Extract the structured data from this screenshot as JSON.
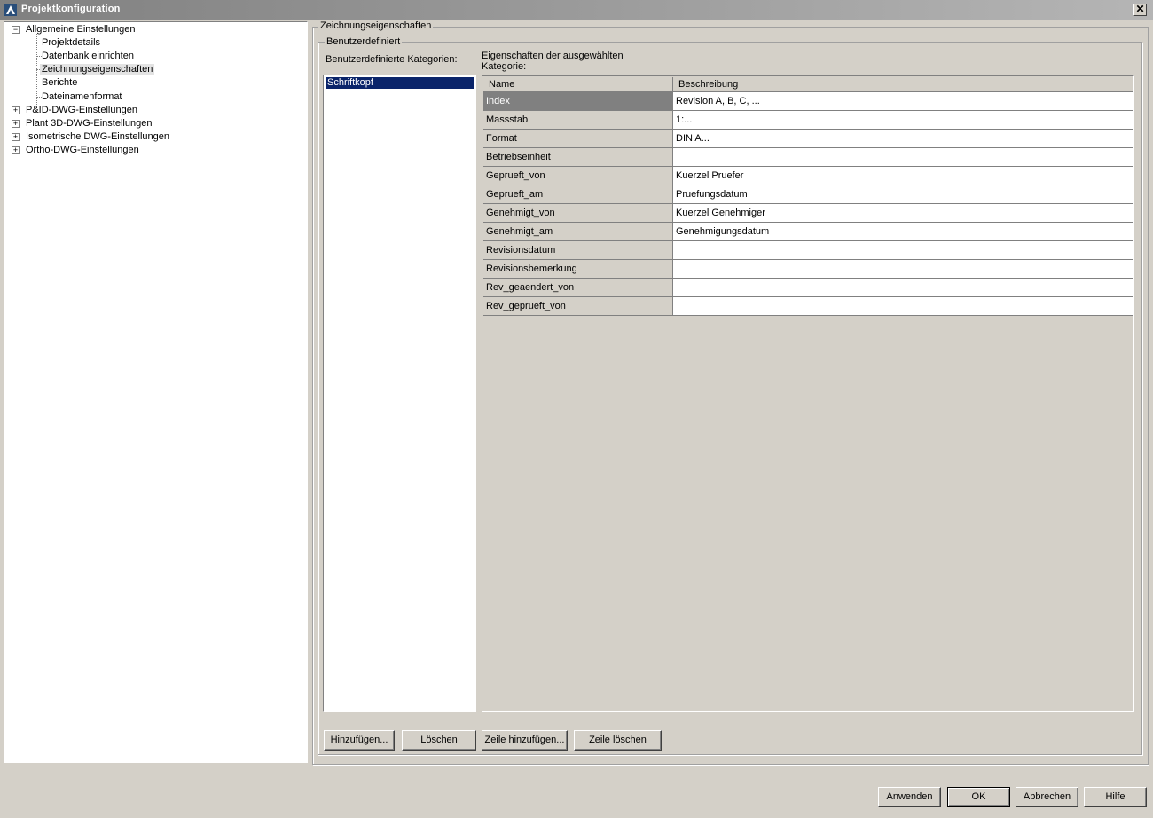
{
  "window": {
    "title": "Projektkonfiguration",
    "close_label": "✕"
  },
  "tree": {
    "root": {
      "label": "Allgemeine Einstellungen",
      "expander": "−",
      "children": [
        "Projektdetails",
        "Datenbank einrichten",
        "Zeichnungseigenschaften",
        "Berichte",
        "Dateinamenformat"
      ],
      "selected_child": "Zeichnungseigenschaften"
    },
    "others": [
      {
        "label": "P&ID-DWG-Einstellungen",
        "expander": "+"
      },
      {
        "label": "Plant 3D-DWG-Einstellungen",
        "expander": "+"
      },
      {
        "label": "Isometrische DWG-Einstellungen",
        "expander": "+"
      },
      {
        "label": "Ortho-DWG-Einstellungen",
        "expander": "+"
      }
    ]
  },
  "panel": {
    "title": "Zeichnungseigenschaften",
    "group_title": "Benutzerdefiniert",
    "categories_label": "Benutzerdefinierte Kategorien:",
    "properties_label_line1": "Eigenschaften der ausgewählten",
    "properties_label_line2": "Kategorie:",
    "categories": [
      "Schriftkopf"
    ],
    "grid": {
      "headers": [
        "Name",
        "Beschreibung"
      ],
      "rows": [
        {
          "name": "Index",
          "desc": "Revision A, B, C, ..."
        },
        {
          "name": "Massstab",
          "desc": "1:..."
        },
        {
          "name": "Format",
          "desc": "DIN A..."
        },
        {
          "name": "Betriebseinheit",
          "desc": ""
        },
        {
          "name": "Geprueft_von",
          "desc": "Kuerzel Pruefer"
        },
        {
          "name": "Geprueft_am",
          "desc": "Pruefungsdatum"
        },
        {
          "name": "Genehmigt_von",
          "desc": "Kuerzel Genehmiger"
        },
        {
          "name": "Genehmigt_am",
          "desc": "Genehmigungsdatum"
        },
        {
          "name": "Revisionsdatum",
          "desc": ""
        },
        {
          "name": "Revisionsbemerkung",
          "desc": ""
        },
        {
          "name": "Rev_geaendert_von",
          "desc": ""
        },
        {
          "name": "Rev_geprueft_von",
          "desc": ""
        }
      ],
      "active_row": "Index"
    },
    "buttons": {
      "add": "Hinzufügen...",
      "delete": "Löschen",
      "add_row": "Zeile hinzufügen...",
      "delete_row": "Zeile löschen"
    }
  },
  "footer": {
    "apply": "Anwenden",
    "ok": "OK",
    "cancel": "Abbrechen",
    "help": "Hilfe"
  }
}
